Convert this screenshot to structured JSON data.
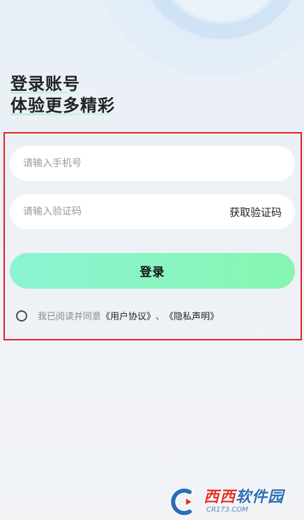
{
  "heading": {
    "line1": "登录账号",
    "line2": "体验更多精彩"
  },
  "phone": {
    "placeholder": "请输入手机号",
    "value": ""
  },
  "code": {
    "placeholder": "请输入验证码",
    "value": "",
    "get_code_label": "获取验证码"
  },
  "login": {
    "label": "登录"
  },
  "agreement": {
    "checked": false,
    "prefix": "我已阅读并同意",
    "user_agreement": "《用户协议》",
    "separator": "、",
    "privacy": "《隐私声明》"
  },
  "watermark": {
    "brand_accent": "西西",
    "brand_rest": "软件园",
    "domain": "CR173.COM",
    "icon": "cr-logo-icon"
  },
  "colors": {
    "login_gradient_start": "#8cf3d3",
    "login_gradient_end": "#86f6b0",
    "highlight_border": "#e02020"
  }
}
